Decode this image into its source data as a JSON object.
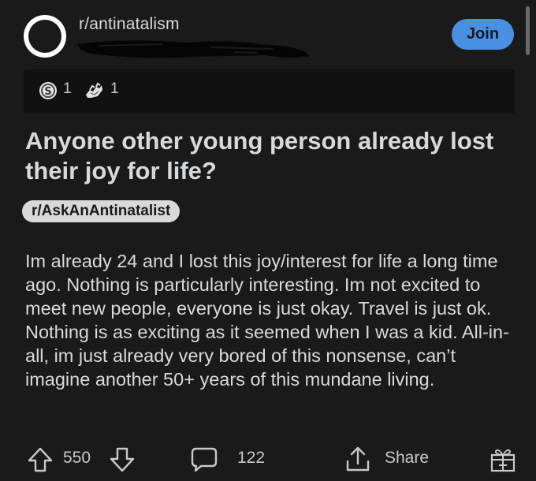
{
  "header": {
    "subreddit": "r/antinatalism",
    "join_label": "Join"
  },
  "awards": [
    {
      "icon": "silver-coin-icon",
      "count": "1"
    },
    {
      "icon": "helping-hand-icon",
      "count": "1"
    }
  ],
  "post": {
    "title": "Anyone other young person already lost their joy for life?",
    "flair": "r/AskAnAntinatalist",
    "body": "Im already 24 and I lost this joy/interest for life a long time ago. Nothing is particularly interesting. Im not excited to meet new people, everyone is just okay. Travel is just ok. Nothing is as exciting as it seemed when I was a kid. All-in-all, im just already very bored of this nonsense, can’t imagine another 50+ years of this mundane living."
  },
  "actions": {
    "score": "550",
    "comments": "122",
    "share_label": "Share"
  },
  "colors": {
    "background": "#1a1a1b",
    "join_button": "#4a90e2",
    "award_bar": "#111112",
    "text": "#d7dadc"
  }
}
